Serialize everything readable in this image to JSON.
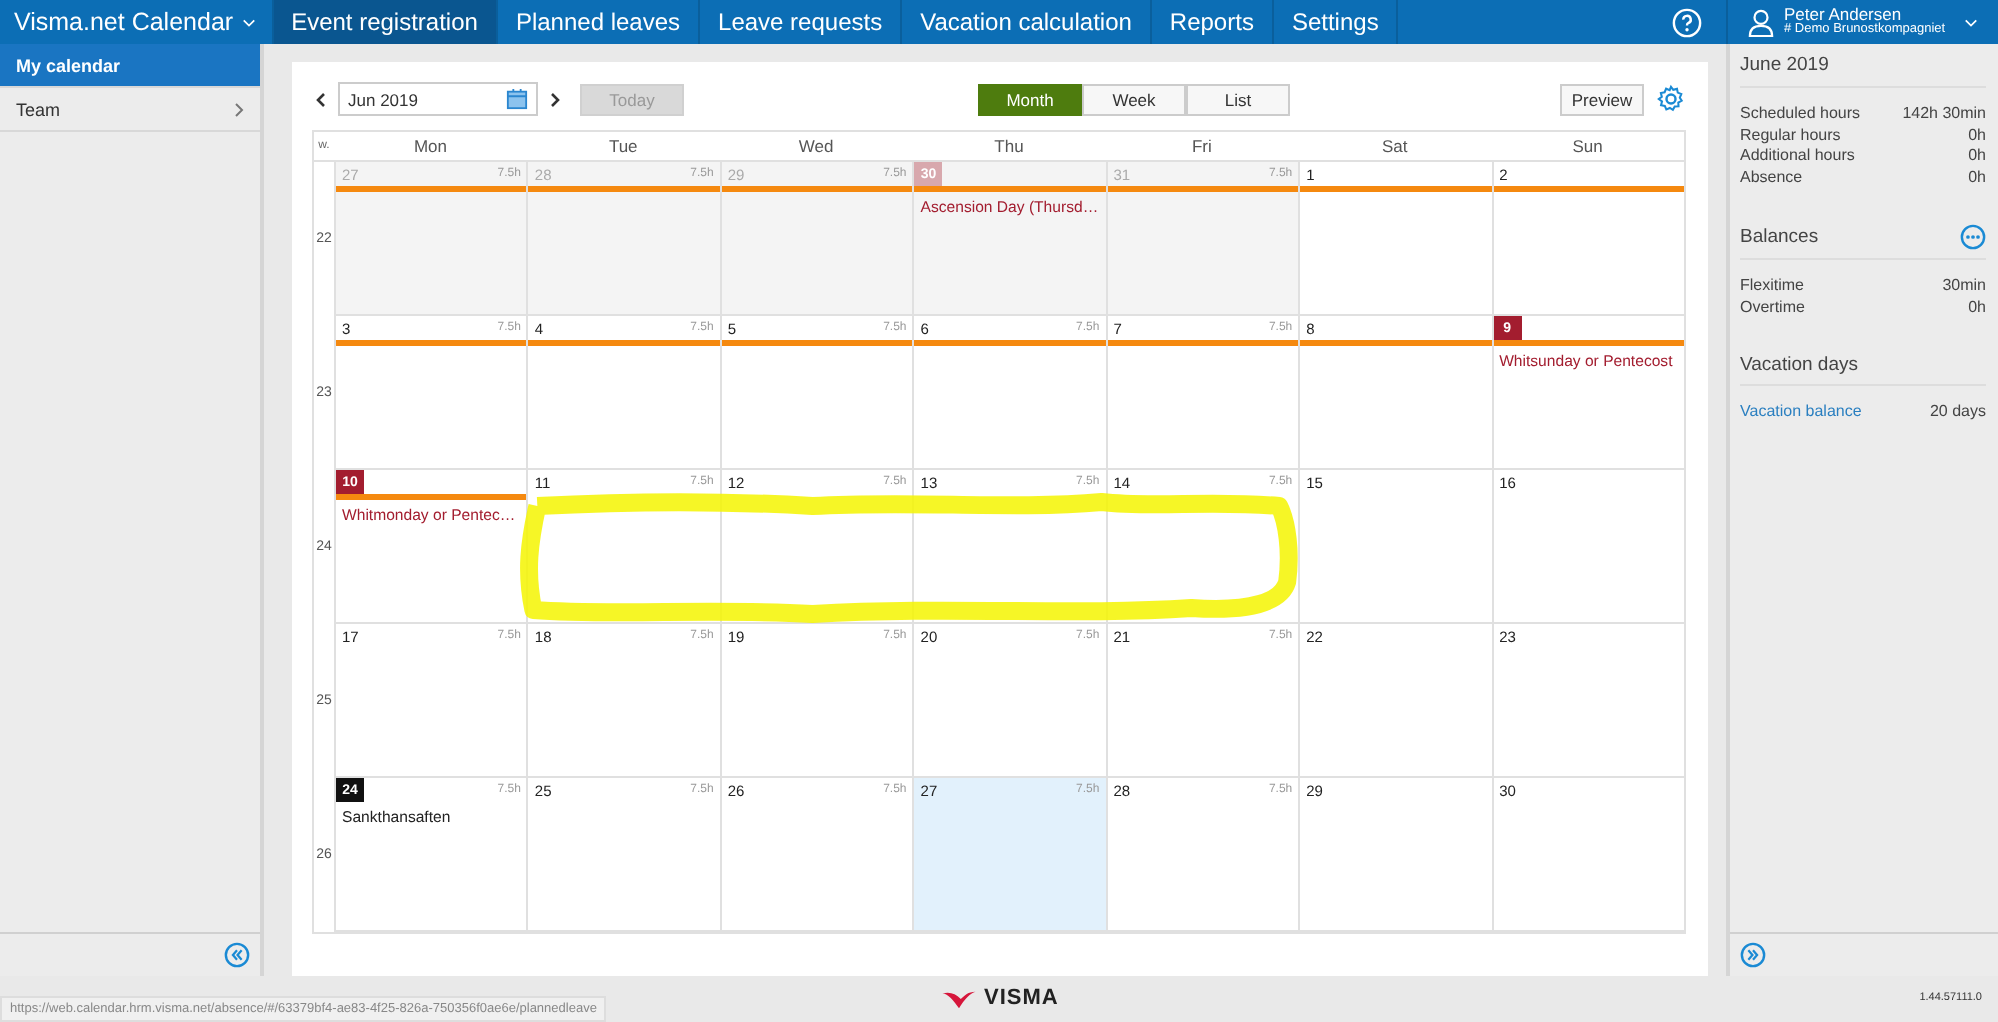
{
  "app": {
    "title": "Visma.net Calendar"
  },
  "tabs": [
    {
      "label": "Event registration",
      "selected": true
    },
    {
      "label": "Planned leaves",
      "selected": false
    },
    {
      "label": "Leave requests",
      "selected": false
    },
    {
      "label": "Vacation calculation",
      "selected": false
    },
    {
      "label": "Reports",
      "selected": false
    },
    {
      "label": "Settings",
      "selected": false
    }
  ],
  "user": {
    "name": "Peter Andersen",
    "company": "# Demo Brunostkompagniet"
  },
  "sidebar": {
    "items": [
      {
        "label": "My calendar",
        "selected": true,
        "has_children": false
      },
      {
        "label": "Team",
        "selected": false,
        "has_children": true
      }
    ]
  },
  "toolbar": {
    "date": "Jun 2019",
    "today": "Today",
    "today_disabled": true,
    "preview": "Preview",
    "views": [
      {
        "label": "Month",
        "selected": true
      },
      {
        "label": "Week",
        "selected": false
      },
      {
        "label": "List",
        "selected": false
      }
    ]
  },
  "calendar": {
    "week_label": "w.",
    "weekdays": [
      "Mon",
      "Tue",
      "Wed",
      "Thu",
      "Fri",
      "Sat",
      "Sun"
    ],
    "weeks": [
      {
        "week": "22",
        "days": [
          {
            "date": "27",
            "hours": "7.5h",
            "muted": true,
            "bar": true,
            "selected": false
          },
          {
            "date": "28",
            "hours": "7.5h",
            "muted": true,
            "bar": true,
            "selected": false
          },
          {
            "date": "29",
            "hours": "7.5h",
            "muted": true,
            "bar": true,
            "selected": false
          },
          {
            "date": "30",
            "muted": true,
            "kind": "holiday",
            "bar": true,
            "selected": false,
            "event": "Ascension Day (Thursd…"
          },
          {
            "date": "31",
            "hours": "7.5h",
            "muted": true,
            "bar": true,
            "selected": false
          },
          {
            "date": "1",
            "muted": false,
            "bar": true,
            "selected": false
          },
          {
            "date": "2",
            "muted": false,
            "bar": true,
            "selected": false
          }
        ]
      },
      {
        "week": "23",
        "days": [
          {
            "date": "3",
            "hours": "7.5h",
            "muted": false,
            "bar": true,
            "selected": false
          },
          {
            "date": "4",
            "hours": "7.5h",
            "muted": false,
            "bar": true,
            "selected": false
          },
          {
            "date": "5",
            "hours": "7.5h",
            "muted": false,
            "bar": true,
            "selected": false
          },
          {
            "date": "6",
            "hours": "7.5h",
            "muted": false,
            "bar": true,
            "selected": false
          },
          {
            "date": "7",
            "hours": "7.5h",
            "muted": false,
            "bar": true,
            "selected": false
          },
          {
            "date": "8",
            "muted": false,
            "bar": true,
            "selected": false
          },
          {
            "date": "9",
            "muted": false,
            "kind": "holiday",
            "bar": true,
            "selected": false,
            "event": "Whitsunday or Pentecost"
          }
        ]
      },
      {
        "week": "24",
        "days": [
          {
            "date": "10",
            "muted": false,
            "kind": "holiday",
            "bar": true,
            "selected": false,
            "event": "Whitmonday or Pentec…"
          },
          {
            "date": "11",
            "hours": "7.5h",
            "muted": false,
            "bar": false,
            "selected": false
          },
          {
            "date": "12",
            "hours": "7.5h",
            "muted": false,
            "bar": false,
            "selected": false
          },
          {
            "date": "13",
            "hours": "7.5h",
            "muted": false,
            "bar": false,
            "selected": false
          },
          {
            "date": "14",
            "hours": "7.5h",
            "muted": false,
            "bar": false,
            "selected": false
          },
          {
            "date": "15",
            "muted": false,
            "bar": false,
            "selected": false
          },
          {
            "date": "16",
            "muted": false,
            "bar": false,
            "selected": false
          }
        ]
      },
      {
        "week": "25",
        "days": [
          {
            "date": "17",
            "hours": "7.5h",
            "muted": false,
            "bar": false,
            "selected": false
          },
          {
            "date": "18",
            "hours": "7.5h",
            "muted": false,
            "bar": false,
            "selected": false
          },
          {
            "date": "19",
            "hours": "7.5h",
            "muted": false,
            "bar": false,
            "selected": false
          },
          {
            "date": "20",
            "hours": "7.5h",
            "muted": false,
            "bar": false,
            "selected": false
          },
          {
            "date": "21",
            "hours": "7.5h",
            "muted": false,
            "bar": false,
            "selected": false
          },
          {
            "date": "22",
            "muted": false,
            "bar": false,
            "selected": false
          },
          {
            "date": "23",
            "muted": false,
            "bar": false,
            "selected": false
          }
        ]
      },
      {
        "week": "26",
        "days": [
          {
            "date": "24",
            "hours": "7.5h",
            "muted": false,
            "kind": "today",
            "bar": false,
            "selected": false,
            "event": "Sankthansaften"
          },
          {
            "date": "25",
            "hours": "7.5h",
            "muted": false,
            "bar": false,
            "selected": false
          },
          {
            "date": "26",
            "hours": "7.5h",
            "muted": false,
            "bar": false,
            "selected": false
          },
          {
            "date": "27",
            "hours": "7.5h",
            "muted": false,
            "bar": false,
            "selected": true
          },
          {
            "date": "28",
            "hours": "7.5h",
            "muted": false,
            "bar": false,
            "selected": false
          },
          {
            "date": "29",
            "muted": false,
            "bar": false,
            "selected": false
          },
          {
            "date": "30",
            "muted": false,
            "bar": false,
            "selected": false
          }
        ]
      }
    ]
  },
  "summary": {
    "title": "June 2019",
    "stats": [
      {
        "label": "Scheduled hours",
        "value": "142h 30min"
      },
      {
        "label": "Regular hours",
        "value": "0h"
      },
      {
        "label": "Additional hours",
        "value": "0h"
      },
      {
        "label": "Absence",
        "value": "0h"
      }
    ],
    "balances_title": "Balances",
    "balances": [
      {
        "label": "Flexitime",
        "value": "30min"
      },
      {
        "label": "Overtime",
        "value": "0h"
      }
    ],
    "vacation_title": "Vacation days",
    "vacation": [
      {
        "label": "Vacation balance",
        "value": "20 days",
        "link": true
      }
    ]
  },
  "footer": {
    "url": "https://web.calendar.hrm.visma.net/absence/#/63379bf4-ae83-4f25-826a-750356f0ae6e/plannedleave",
    "logo": "VISMA",
    "version": "1.44.57111.0"
  }
}
